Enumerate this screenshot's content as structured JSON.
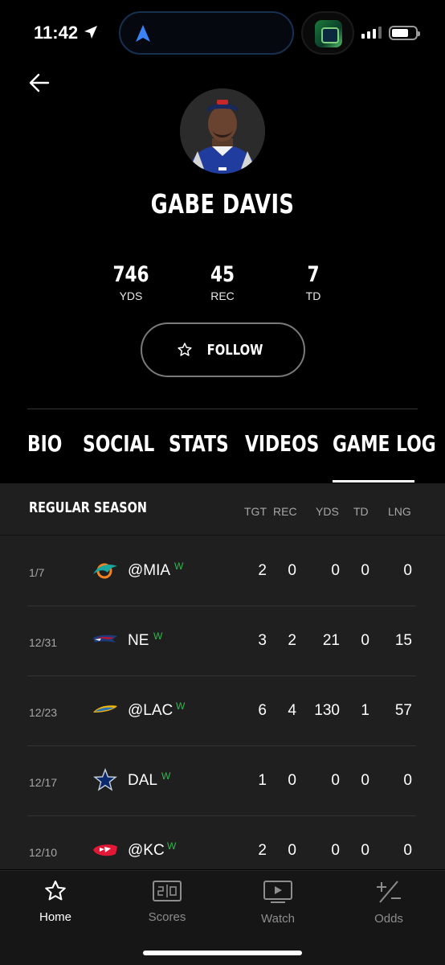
{
  "status_bar": {
    "time": "11:42"
  },
  "player": {
    "name": "GABE DAVIS"
  },
  "stats": [
    {
      "value": "746",
      "label": "YDS"
    },
    {
      "value": "45",
      "label": "REC"
    },
    {
      "value": "7",
      "label": "TD"
    }
  ],
  "follow_label": "FOLLOW",
  "tabs": [
    {
      "label": "BIO"
    },
    {
      "label": "SOCIAL"
    },
    {
      "label": "STATS"
    },
    {
      "label": "VIDEOS"
    },
    {
      "label": "GAME LOG",
      "active": true
    }
  ],
  "game_log": {
    "section_title": "REGULAR SEASON",
    "columns": [
      "TGT",
      "REC",
      "YDS",
      "TD",
      "LNG"
    ],
    "rows": [
      {
        "date": "1/7",
        "opponent": "@MIA",
        "result": "W",
        "team_icon": "dolphins-logo",
        "tgt": "2",
        "rec": "0",
        "yds": "0",
        "td": "0",
        "lng": "0"
      },
      {
        "date": "12/31",
        "opponent": "NE",
        "result": "W",
        "team_icon": "patriots-logo",
        "tgt": "3",
        "rec": "2",
        "yds": "21",
        "td": "0",
        "lng": "15"
      },
      {
        "date": "12/23",
        "opponent": "@LAC",
        "result": "W",
        "team_icon": "chargers-logo",
        "tgt": "6",
        "rec": "4",
        "yds": "130",
        "td": "1",
        "lng": "57"
      },
      {
        "date": "12/17",
        "opponent": "DAL",
        "result": "W",
        "team_icon": "cowboys-logo",
        "tgt": "1",
        "rec": "0",
        "yds": "0",
        "td": "0",
        "lng": "0"
      },
      {
        "date": "12/10",
        "opponent": "@KC",
        "result": "W",
        "team_icon": "chiefs-logo",
        "tgt": "2",
        "rec": "0",
        "yds": "0",
        "td": "0",
        "lng": "0"
      }
    ]
  },
  "bottom_nav": [
    {
      "label": "Home",
      "icon": "star-icon",
      "active": true
    },
    {
      "label": "Scores",
      "icon": "scoreboard-icon"
    },
    {
      "label": "Watch",
      "icon": "play-screen-icon"
    },
    {
      "label": "Odds",
      "icon": "plus-minus-icon"
    }
  ],
  "colors": {
    "background": "#000000",
    "panel": "#1f1f1f",
    "win": "#2dba4e",
    "nav_inactive": "#8d8d8d"
  }
}
